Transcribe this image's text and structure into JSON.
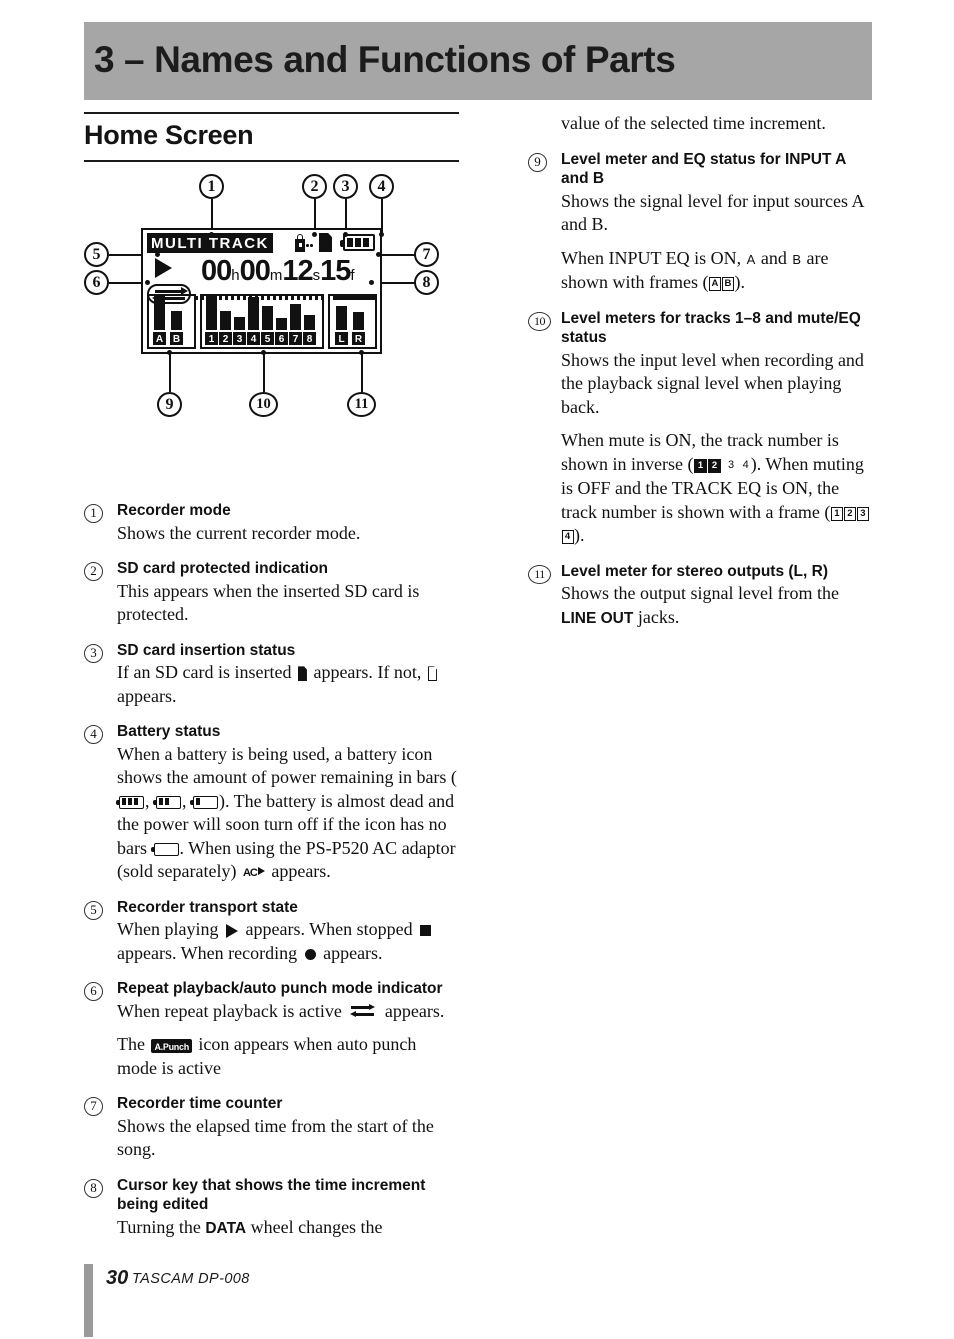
{
  "chapter": {
    "title": "3 – Names and Functions of Parts",
    "banner_color": "#a6a6a6"
  },
  "section": {
    "heading": "Home Screen"
  },
  "figure": {
    "name": "home-screen-lcd-diagram",
    "callouts": [
      "1",
      "2",
      "3",
      "4",
      "5",
      "6",
      "7",
      "8",
      "9",
      "10",
      "11"
    ],
    "lcd": {
      "mode_label": "MULTI TRACK",
      "icons": [
        "card-lock-icon",
        "sd-card-icon",
        "battery-icon"
      ],
      "transport_state": "play",
      "repeat_indicator": "repeat-playback-icon",
      "time": {
        "hours": "00",
        "hours_unit": "h",
        "minutes": "00",
        "minutes_unit": "m",
        "seconds": "12",
        "seconds_unit": "s",
        "frames": "15",
        "frames_unit": "f"
      },
      "meters": {
        "input_group": {
          "labels": [
            "A",
            "B"
          ],
          "values": [
            88,
            52
          ],
          "peak_caps": [
            true,
            false
          ]
        },
        "track_group": {
          "labels": [
            "1",
            "2",
            "3",
            "4",
            "5",
            "6",
            "7",
            "8"
          ],
          "values": [
            88,
            52,
            36,
            84,
            66,
            32,
            70,
            42
          ],
          "peak_caps": [
            true,
            false,
            false,
            true,
            false,
            false,
            false,
            false
          ]
        },
        "output_group": {
          "labels": [
            "L",
            "R"
          ],
          "values": [
            66,
            50
          ],
          "peak_caps": [
            false,
            false
          ]
        }
      }
    }
  },
  "items": [
    {
      "num": "1",
      "head": "Recorder mode",
      "body": "Shows the current recorder mode."
    },
    {
      "num": "2",
      "head": "SD card protected indication",
      "body": "This appears when the inserted SD card is protected."
    },
    {
      "num": "3",
      "head": "SD card insertion status",
      "body_a": "If an SD card is inserted",
      "body_b": "appears. If not,",
      "body_c": "appears."
    },
    {
      "num": "4",
      "head": "Battery status",
      "body_a": "When a battery is being used, a battery icon shows the amount of power remaining in bars (",
      "body_b": ",",
      "body_c": ",",
      "body_d": "). The battery is almost dead and the power will soon turn off if the icon has no bars",
      "body_e": ". When using the PS-P520 AC adaptor (sold separately)",
      "ac_label": "AC",
      "body_f": "appears."
    },
    {
      "num": "5",
      "head": "Recorder transport state",
      "body_a": "When playing",
      "body_b": "appears. When stopped",
      "body_c": "appears. When recording",
      "body_d": "appears."
    },
    {
      "num": "6",
      "head": "Repeat playback/auto punch mode indicator",
      "body_a": "When repeat playback is active",
      "body_b": "appears.",
      "body_c": "The",
      "apunch_label": "A.Punch",
      "body_d": "icon appears when auto punch mode is active"
    },
    {
      "num": "7",
      "head": "Recorder time counter",
      "body": "Shows the elapsed time from the start of the song."
    },
    {
      "num": "8",
      "head": "Cursor key that shows the time increment being edited",
      "body_a": "Turning the",
      "body_bold": "DATA",
      "body_b": "wheel changes the"
    }
  ],
  "right_column": {
    "continued": "value of the selected time increment.",
    "items": [
      {
        "num": "9",
        "head": "Level meter and EQ status for INPUT A and B",
        "body_a": "Shows the signal level for input sources A and B.",
        "body_b": "When INPUT EQ is ON,",
        "glyph_a": "A",
        "body_c": "and",
        "glyph_b": "B",
        "body_d": "are shown with frames (",
        "framed_a": "A",
        "framed_b": "B",
        "body_e": ")."
      },
      {
        "num": "10",
        "head": "Level meters for tracks 1–8 and mute/EQ status",
        "body_a": "Shows the input level when recording and the playback signal level when playing back.",
        "body_b": "When mute is ON, the track number is shown in inverse (",
        "inverse_1": "1",
        "inverse_2": "2",
        "plain_3": "3",
        "plain_4": "4",
        "body_c": "). When muting is OFF and the TRACK EQ is ON, the track number is shown with a frame (",
        "framed_1": "1",
        "framed_2": "2",
        "framed_3": "3",
        "framed_4": "4",
        "body_d": ")."
      },
      {
        "num": "11",
        "head": "Level meter for stereo outputs (L, R)",
        "body_a": "Shows the output signal level from the",
        "body_bold": "LINE OUT",
        "body_b": "jacks."
      }
    ]
  },
  "footer": {
    "page_number": "30",
    "model": "TASCAM  DP-008"
  }
}
